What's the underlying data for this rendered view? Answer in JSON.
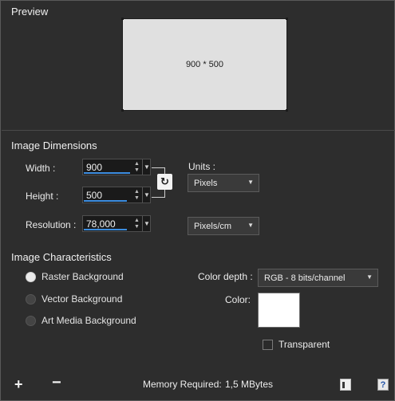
{
  "preview": {
    "title": "Preview",
    "size_label": "900 * 500"
  },
  "dimensions": {
    "title": "Image Dimensions",
    "width_label": "Width :",
    "width_value": "900",
    "height_label": "Height :",
    "height_value": "500",
    "resolution_label": "Resolution :",
    "resolution_value": "78,000",
    "units_label": "Units :",
    "units_value": "Pixels",
    "resolution_units_value": "Pixels/cm"
  },
  "characteristics": {
    "title": "Image Characteristics",
    "options": [
      {
        "label": "Raster Background",
        "selected": true
      },
      {
        "label": "Vector Background",
        "selected": false
      },
      {
        "label": "Art Media Background",
        "selected": false
      }
    ],
    "color_depth_label": "Color depth :",
    "color_depth_value": "RGB - 8 bits/channel",
    "color_label": "Color:",
    "color_value": "#ffffff",
    "transparent_label": "Transparent",
    "transparent_checked": false
  },
  "footer": {
    "memory_label": "Memory Required:",
    "memory_value": "1,5 MBytes",
    "add_icon": "plus-icon",
    "remove_icon": "minus-icon",
    "preset_icon": "document-icon",
    "help_icon": "help-icon",
    "help_glyph": "?"
  }
}
